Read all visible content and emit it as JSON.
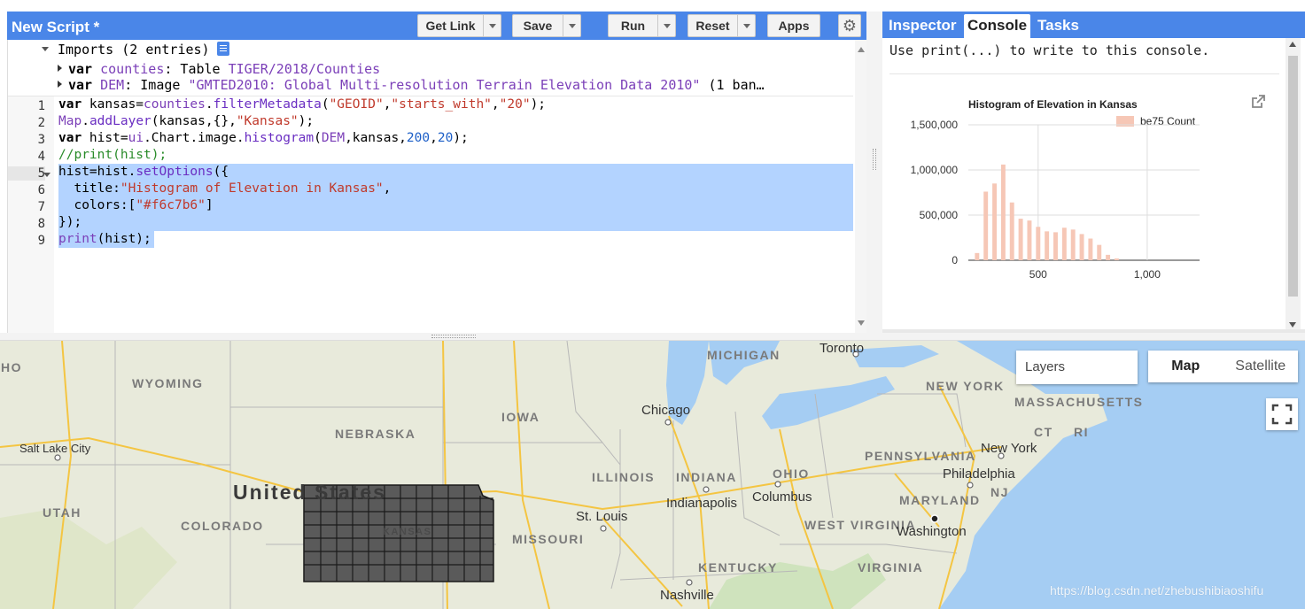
{
  "editor": {
    "title": "New Script *",
    "buttons": {
      "get_link": "Get Link",
      "save": "Save",
      "run": "Run",
      "reset": "Reset",
      "apps": "Apps"
    },
    "imports": {
      "header": "Imports (2 entries)",
      "entries": [
        {
          "kw": "var",
          "name": "counties",
          "rest": ": Table ",
          "source": "TIGER/2018/Counties"
        },
        {
          "kw": "var",
          "name": "DEM",
          "rest": ": Image ",
          "source": "\"GMTED2010: Global Multi-resolution Terrain Elevation Data 2010\"",
          "tail": " (1 ban…"
        }
      ]
    },
    "line_numbers": [
      "1",
      "2",
      "3",
      "4",
      "5",
      "6",
      "7",
      "8",
      "9"
    ],
    "code_lines": [
      "var kansas=counties.filterMetadata(\"GEOID\",\"starts_with\",\"20\");",
      "Map.addLayer(kansas,{},\"Kansas\");",
      "var hist=ui.Chart.image.histogram(DEM,kansas,200,20);",
      "//print(hist);",
      "hist=hist.setOptions({",
      "  title:\"Histogram of Elevation in Kansas\",",
      "  colors:[\"#f6c7b6\"]",
      "});",
      "print(hist);"
    ]
  },
  "right_panel": {
    "tabs": [
      "Inspector",
      "Console",
      "Tasks"
    ],
    "active_tab": "Console",
    "console_message": "Use print(...) to write to this console."
  },
  "chart_data": {
    "type": "bar",
    "title": "Histogram of Elevation in Kansas",
    "legend": "be75 Count",
    "legend_position": "top-right",
    "color": "#f6c7b6",
    "x": [
      220,
      260,
      300,
      340,
      380,
      420,
      460,
      500,
      540,
      580,
      620,
      660,
      700,
      740,
      780,
      820,
      860,
      900,
      940,
      980,
      1020,
      1060,
      1100,
      1140,
      1180
    ],
    "values": [
      80000,
      760000,
      850000,
      1060000,
      640000,
      460000,
      440000,
      370000,
      320000,
      310000,
      360000,
      340000,
      290000,
      240000,
      170000,
      60000,
      20000
    ],
    "xlim": [
      180,
      1240
    ],
    "ylim": [
      0,
      1500000
    ],
    "y_ticks": [
      "0",
      "500,000",
      "1,000,000",
      "1,500,000"
    ],
    "x_ticks": [
      "500",
      "1,000"
    ],
    "x_tick_values": [
      500,
      1000
    ],
    "grid": true
  },
  "map": {
    "layers_label": "Layers",
    "map_type": [
      "Map",
      "Satellite"
    ],
    "active_map_type": "Map",
    "states": [
      "WYOMING",
      "NEBRASKA",
      "IOWA",
      "MICHIGAN",
      "NEW YORK",
      "MASSACHUSETTS",
      "ILLINOIS",
      "INDIANA",
      "OHIO",
      "PENNSYLVANIA",
      "UTAH",
      "COLORADO",
      "MISSOURI",
      "KENTUCKY",
      "WEST VIRGINIA",
      "VIRGINIA",
      "MARYLAND",
      "NJ",
      "CT",
      "RI",
      "KANSAS",
      "HO"
    ],
    "cities": [
      "Salt Lake City",
      "Toronto",
      "Chicago",
      "New York",
      "Philadelphia",
      "Indianapolis",
      "Columbus",
      "St. Louis",
      "Washington",
      "Nashville"
    ],
    "country": "United States",
    "watermark": "https://blog.csdn.net/zhebushibiaoshifu"
  },
  "colors": {
    "header_blue": "#4a86e8",
    "selection": "#b3d3ff",
    "bar": "#f6c7b6",
    "water": "#a5cdf3",
    "land": "#e8eadb"
  }
}
